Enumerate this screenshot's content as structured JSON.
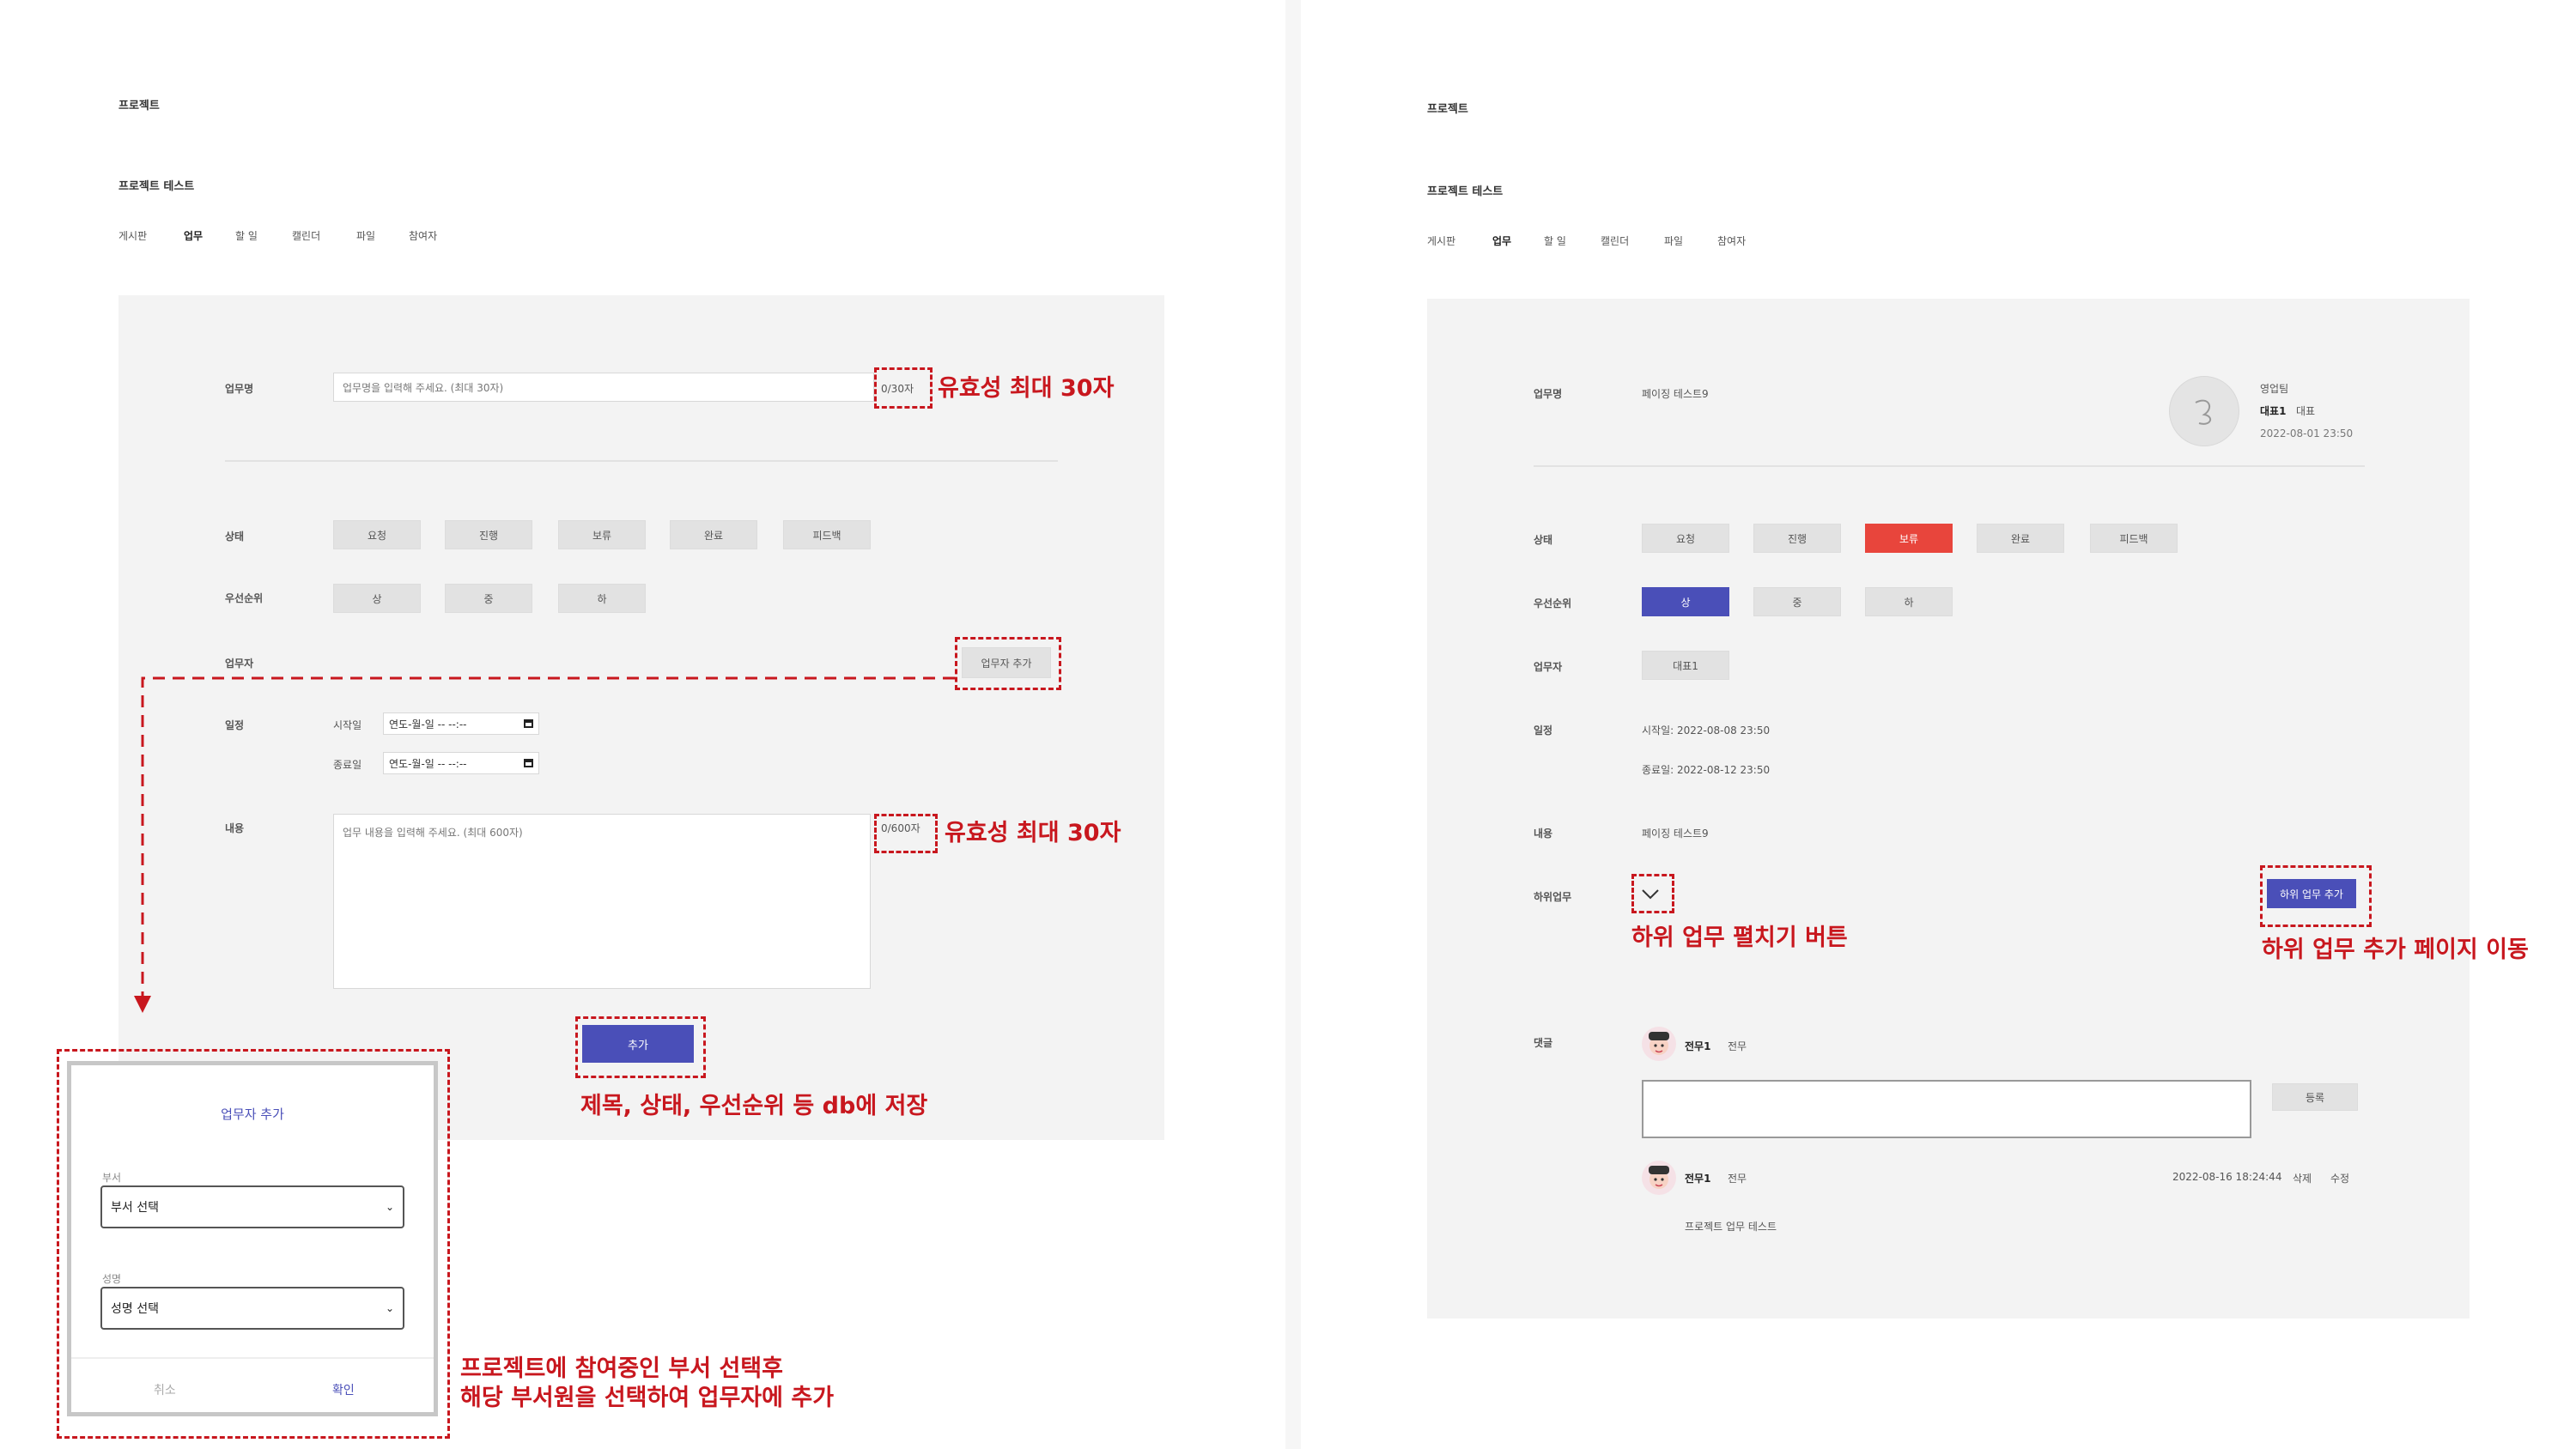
{
  "left": {
    "header": {
      "title": "프로젝트",
      "project_name": "프로젝트 테스트"
    },
    "tabs": [
      "게시판",
      "업무",
      "할 일",
      "캘린더",
      "파일",
      "참여자"
    ],
    "form": {
      "task_name_label": "업무명",
      "task_name_placeholder": "업무명을 입력해 주세요. (최대 30자)",
      "task_name_counter": "0/30자",
      "status_label": "상태",
      "status_options": [
        "요청",
        "진행",
        "보류",
        "완료",
        "피드백"
      ],
      "priority_label": "우선순위",
      "priority_options": [
        "상",
        "중",
        "하"
      ],
      "assignee_label": "업무자",
      "add_assignee_button": "업무자 추가",
      "schedule_label": "일정",
      "start_label": "시작일",
      "end_label": "종료일",
      "date_placeholder": "연도-월-일 -- --:--",
      "content_label": "내용",
      "content_placeholder": "업무 내용을 입력해 주세요. (최대 600자)",
      "content_counter": "0/600자",
      "submit_button": "추가"
    },
    "modal": {
      "title": "업무자 추가",
      "dept_label": "부서",
      "dept_select": "부서 선택",
      "name_label": "성명",
      "name_select": "성명 선택",
      "cancel": "취소",
      "confirm": "확인"
    },
    "annotations": {
      "title_limit": "유효성 최대 30자",
      "content_limit": "유효성 최대 30자",
      "save_note": "제목, 상태, 우선순위 등 db에 저장",
      "modal_note_1": "프로젝트에 참여중인 부서 선택후",
      "modal_note_2": "해당 부서원을 선택하여 업무자에 추가"
    }
  },
  "right": {
    "header": {
      "title": "프로젝트",
      "project_name": "프로젝트 테스트"
    },
    "tabs": [
      "게시판",
      "업무",
      "할 일",
      "캘린더",
      "파일",
      "참여자"
    ],
    "detail": {
      "task_name_label": "업무명",
      "task_name_value": "페이징 테스트9",
      "author_team": "영업팀",
      "author_name": "대표1",
      "author_role": "대표",
      "author_date": "2022-08-01 23:50",
      "status_label": "상태",
      "status_options": [
        "요청",
        "진행",
        "보류",
        "완료",
        "피드백"
      ],
      "status_selected": "보류",
      "priority_label": "우선순위",
      "priority_options": [
        "상",
        "중",
        "하"
      ],
      "priority_selected": "상",
      "assignee_label": "업무자",
      "assignee_value": "대표1",
      "schedule_label": "일정",
      "start_text": "시작일: 2022-08-08 23:50",
      "end_text": "종료일: 2022-08-12 23:50",
      "content_label": "내용",
      "content_value": "페이징 테스트9",
      "subtask_label": "하위업무",
      "add_subtask_button": "하위 업무 추가",
      "comment_label": "댓글",
      "commenter_name": "전무1",
      "commenter_role": "전무",
      "register_button": "등록",
      "comment_author": "전무1",
      "comment_role": "전무",
      "comment_date": "2022-08-16 18:24:44",
      "comment_delete": "삭제",
      "comment_edit": "수정",
      "comment_text": "프로젝트 업무 테스트"
    },
    "annotations": {
      "expand_note": "하위 업무 펼치기 버튼",
      "add_page_note": "하위 업무 추가 페이지 이동"
    }
  },
  "colors": {
    "accent_blue": "#4a4fb8",
    "status_red": "#e8453c",
    "annotation_red": "#c8171e",
    "panel_gray": "#f3f3f3"
  }
}
